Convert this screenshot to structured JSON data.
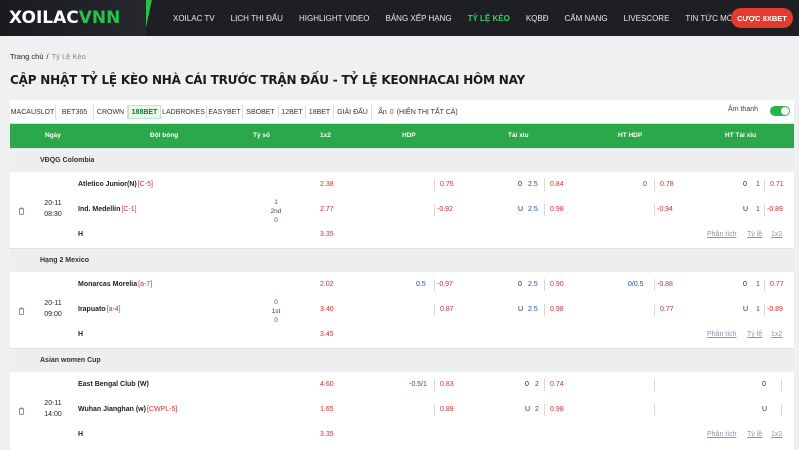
{
  "header": {
    "logo_a": "XOILAC",
    "logo_b": "VNN",
    "nav": [
      "XOILAC TV",
      "LỊCH THI ĐẤU",
      "HIGHLIGHT VIDEO",
      "BẢNG XẾP HẠNG",
      "TỶ LỆ KÈO",
      "KQBĐ",
      "CẨM NANG",
      "LIVESCORE",
      "TIN TỨC MỚI"
    ],
    "bet_button": "CƯỢC 8XBET"
  },
  "breadcrumb": {
    "home": "Trang chủ",
    "sep": "/",
    "current": "Tỷ Lệ Kèo"
  },
  "title": "CẬP NHẬT TỶ LỆ KÈO NHÀ CÁI TRƯỚC TRẬN ĐẤU - TỶ LỆ KEONHACAI HÔM NAY",
  "tabs": [
    "MACAUSLOT",
    "BET365",
    "CROWN",
    "188BET",
    "LADBROKES",
    "EASYBET",
    "SBOBET",
    "12BET",
    "18BET",
    "GIẢI ĐẤU"
  ],
  "hidden": {
    "label": "Ẩn",
    "count": "0",
    "show_all": "(HIỂN THỊ TẤT CẢ)"
  },
  "sound_label": "Âm thanh",
  "columns": [
    "Ngày",
    "Đội bóng",
    "Tỷ số",
    "1x2",
    "HDP",
    "Tài xỉu",
    "HT HDP",
    "HT Tài xỉu"
  ],
  "links": [
    "Phân tích",
    "Tỷ lệ",
    "1x2"
  ],
  "leagues": [
    {
      "name": "VĐQG Colombia",
      "date": "20-11",
      "time": "08:30",
      "home": "Atletico Junior(N)",
      "home_rank": "[C-5]",
      "away": "Ind. Medellin",
      "away_rank": "[C-1]",
      "draw": "H",
      "score": [
        "1",
        "2nd",
        "0"
      ],
      "x12": [
        "2.38",
        "2.77",
        "3.35"
      ],
      "hdp": {
        "line1": "",
        "line2": "",
        "odd1": "0.75",
        "odd2": "-0.92"
      },
      "ou": {
        "a": "0",
        "b": "U",
        "line1": "2.5",
        "line2": "2.5",
        "odd1": "0.84",
        "odd2": "0.98"
      },
      "hthdp": {
        "line": "0",
        "odd1": "0.78",
        "odd2": "-0.94"
      },
      "htou": {
        "a": "0",
        "b": "U",
        "line1": "1",
        "line2": "1",
        "odd1": "0.71",
        "odd2": "-0.89"
      }
    },
    {
      "name": "Hạng 2 Mexico",
      "date": "20-11",
      "time": "09:00",
      "home": "Monarcas Morelia",
      "home_rank": "[a-7]",
      "away": "Irapuato",
      "away_rank": "[a-4]",
      "draw": "H",
      "score": [
        "0",
        "1st",
        "0"
      ],
      "x12": [
        "2.02",
        "3.40",
        "3.45"
      ],
      "hdp": {
        "line1": "0.5",
        "line2": "",
        "odd1": "-0.97",
        "odd2": "0.87"
      },
      "ou": {
        "a": "0",
        "b": "U",
        "line1": "2.5",
        "line2": "2.5",
        "odd1": "0.90",
        "odd2": "0.98"
      },
      "hthdp": {
        "line": "0/0.5",
        "odd1": "-0.88",
        "odd2": "0.77"
      },
      "htou": {
        "a": "0",
        "b": "U",
        "line1": "1",
        "line2": "1",
        "odd1": "0.77",
        "odd2": "-0.89"
      }
    },
    {
      "name": "Asian women Cup",
      "date": "20-11",
      "time": "14:00",
      "home": "East Bengal Club (W)",
      "home_rank": "",
      "away": "Wuhan Jianghan (w)",
      "away_rank": "[CWPL-5]",
      "draw": "H",
      "score": [
        "",
        "",
        ""
      ],
      "x12": [
        "4.60",
        "1.65",
        "3.35"
      ],
      "hdp": {
        "line1": "-0.5/1",
        "line2": "",
        "odd1": "0.83",
        "odd2": "0.89"
      },
      "ou": {
        "a": "0",
        "b": "U",
        "line1": "2",
        "line2": "2",
        "odd1": "0.74",
        "odd2": "0.98"
      },
      "hthdp": {
        "line": "",
        "odd1": "",
        "odd2": ""
      },
      "htou": {
        "a": "0",
        "b": "U",
        "line1": "",
        "line2": "",
        "odd1": "",
        "odd2": ""
      }
    }
  ]
}
